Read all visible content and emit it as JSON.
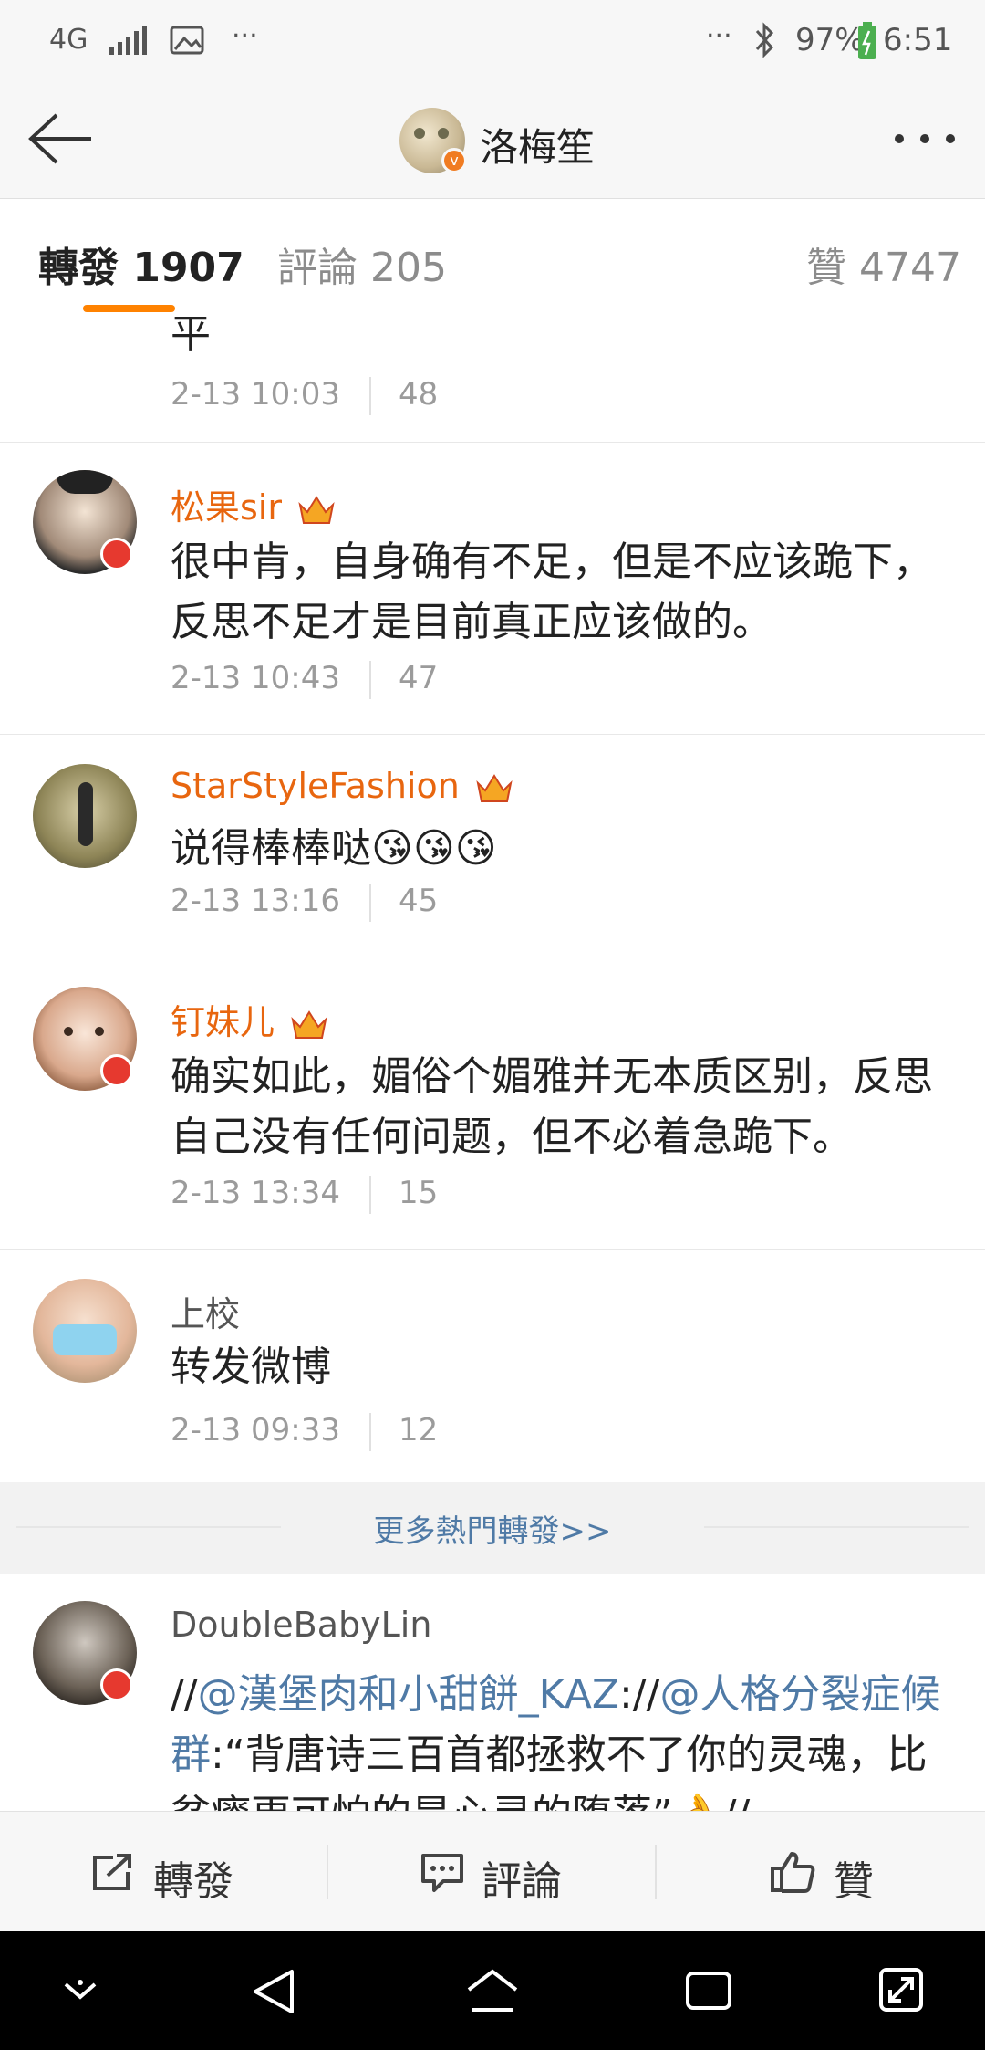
{
  "status_bar": {
    "network": "4G",
    "extra": "···",
    "extra_right": "···",
    "battery": "97%",
    "time": "6:51"
  },
  "nav": {
    "title": "洛梅笙",
    "back_icon": "back-arrow-icon",
    "more_icon": "more-dots-icon"
  },
  "tabs": [
    {
      "label": "轉發",
      "count": "1907"
    },
    {
      "label": "評論",
      "count": "205"
    },
    {
      "label": "贊",
      "count": "4747"
    }
  ],
  "comments": [
    {
      "name": "",
      "text": "平",
      "time": "2-13 10:03",
      "likes": "48"
    },
    {
      "name": "松果sir",
      "text": "很中肯，自身确有不足，但是不应该跪下，反思不足才是目前真正应该做的。",
      "time": "2-13 10:43",
      "likes": "47"
    },
    {
      "name": "StarStyleFashion",
      "text": "说得棒棒哒😘😘😘",
      "time": "2-13 13:16",
      "likes": "45"
    },
    {
      "name": "钉妹儿",
      "text": "确实如此，媚俗个媚雅并无本质区别，反思自己没有任何问题，但不必着急跪下。",
      "time": "2-13 13:34",
      "likes": "15"
    },
    {
      "name": "上校",
      "text": "转发微博",
      "time": "2-13 09:33",
      "likes": "12"
    }
  ],
  "more_hot": "更多熱門轉發>>",
  "latest": {
    "name": "DoubleBabyLin",
    "prefix1": "//",
    "mention1": "@漢堡肉和小甜餅_KAZ",
    "mid": "://",
    "mention2": "@人格分裂症候群",
    "quote": ":“背唐诗三百首都拯救不了你的灵魂，比贫瘠更可怕的是心灵的堕落”👌//"
  },
  "actions": {
    "repost": "轉發",
    "comment": "評論",
    "like": "贊"
  },
  "colors": {
    "accent": "#ff8200",
    "vip_name": "#e8660f",
    "link": "#4f7aa6",
    "badge": "#e6392f"
  }
}
